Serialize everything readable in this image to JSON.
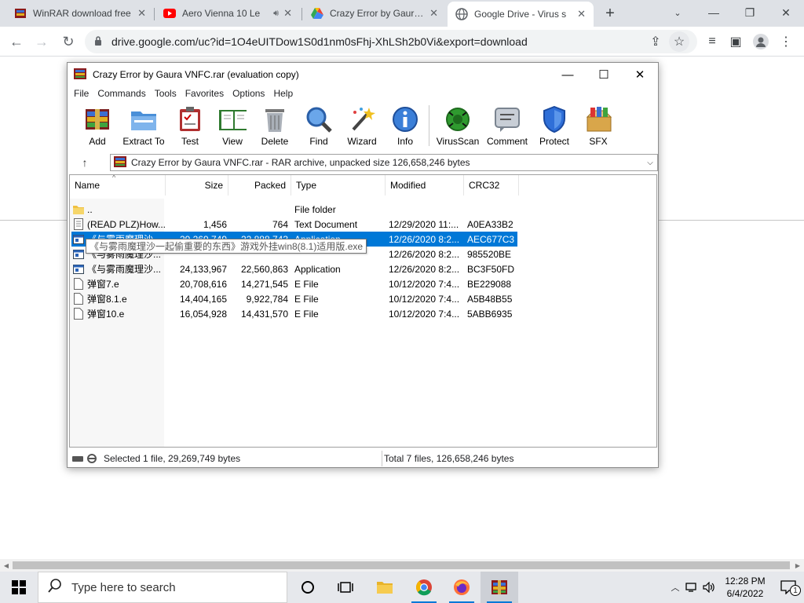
{
  "browser": {
    "tabs": [
      {
        "title": "WinRAR download free",
        "icon": "winrar-icon"
      },
      {
        "title": "Aero Vienna 10 Le",
        "icon": "youtube-icon",
        "audio": "speaker-icon"
      },
      {
        "title": "Crazy Error by Gaura V",
        "icon": "google-drive-icon"
      },
      {
        "title": "Google Drive - Virus s",
        "icon": "globe-icon"
      }
    ],
    "url": "drive.google.com/uc?id=1O4eUITDow1S0d1nm0sFhj-XhLSh2b0Vi&export=download"
  },
  "winrar": {
    "title": "Crazy Error by Gaura VNFC.rar (evaluation copy)",
    "menu": [
      "File",
      "Commands",
      "Tools",
      "Favorites",
      "Options",
      "Help"
    ],
    "tools": [
      "Add",
      "Extract To",
      "Test",
      "View",
      "Delete",
      "Find",
      "Wizard",
      "Info",
      "VirusScan",
      "Comment",
      "Protect",
      "SFX"
    ],
    "address": "Crazy Error by Gaura VNFC.rar - RAR archive, unpacked size 126,658,246 bytes",
    "columns": [
      "Name",
      "Size",
      "Packed",
      "Type",
      "Modified",
      "CRC32"
    ],
    "files": [
      {
        "name": "..",
        "size": "",
        "packed": "",
        "type": "File folder",
        "modified": "",
        "crc": "",
        "kind": "folder"
      },
      {
        "name": "(READ PLZ)How...",
        "size": "1,456",
        "packed": "764",
        "type": "Text Document",
        "modified": "12/29/2020 11:...",
        "crc": "A0EA33B2",
        "kind": "text"
      },
      {
        "name": "《与雾雨魔理沙...",
        "size": "29,269,749",
        "packed": "22,888,743",
        "type": "Application",
        "modified": "12/26/2020 8:2...",
        "crc": "AEC677C3",
        "kind": "app"
      },
      {
        "name": "《与雾雨魔理沙...",
        "size": "",
        "packed": "",
        "type": "",
        "modified": "12/26/2020 8:2...",
        "crc": "985520BE",
        "kind": "app"
      },
      {
        "name": "《与雾雨魔理沙...",
        "size": "24,133,967",
        "packed": "22,560,863",
        "type": "Application",
        "modified": "12/26/2020 8:2...",
        "crc": "BC3F50FD",
        "kind": "app"
      },
      {
        "name": "弹窗7.e",
        "size": "20,708,616",
        "packed": "14,271,545",
        "type": "E File",
        "modified": "10/12/2020 7:4...",
        "crc": "BE229088",
        "kind": "file"
      },
      {
        "name": "弹窗8.1.e",
        "size": "14,404,165",
        "packed": "9,922,784",
        "type": "E File",
        "modified": "10/12/2020 7:4...",
        "crc": "A5B48B55",
        "kind": "file"
      },
      {
        "name": "弹窗10.e",
        "size": "16,054,928",
        "packed": "14,431,570",
        "type": "E File",
        "modified": "10/12/2020 7:4...",
        "crc": "5ABB6935",
        "kind": "file"
      }
    ],
    "tooltip": "《与雾雨魔理沙一起偷重要的东西》游戏外挂win8(8.1)适用版.exe",
    "status_left": "Selected 1 file, 29,269,749 bytes",
    "status_right": "Total 7 files, 126,658,246 bytes"
  },
  "taskbar": {
    "search_placeholder": "Type here to search",
    "time": "12:28 PM",
    "date": "6/4/2022",
    "notification_count": "1"
  }
}
